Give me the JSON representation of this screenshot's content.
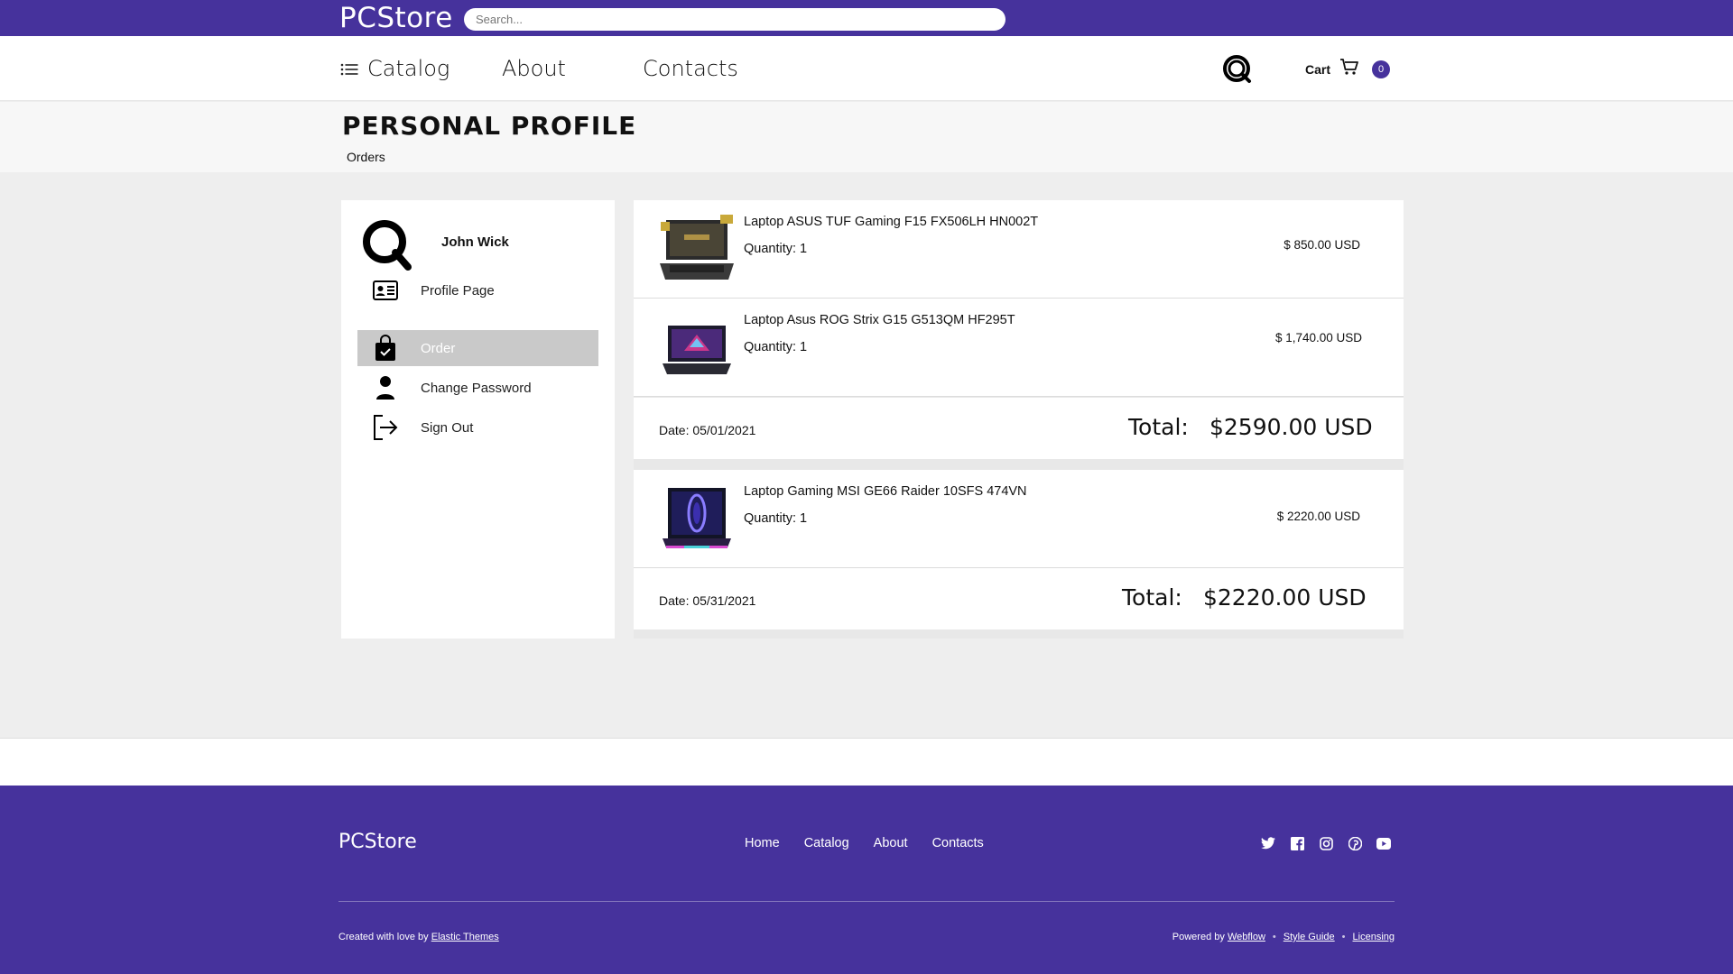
{
  "topbar": {
    "brand": "PCStore",
    "search_placeholder": "Search..."
  },
  "nav": {
    "catalog": "Catalog",
    "about": "About",
    "contacts": "Contacts",
    "cart_label": "Cart",
    "cart_count": "0"
  },
  "page": {
    "title": "PERSONAL PROFILE",
    "breadcrumb": "Orders"
  },
  "sidebar": {
    "username": "John Wick",
    "items": [
      {
        "label": "Profile Page",
        "icon": "id-card-icon"
      },
      {
        "label": "Order",
        "icon": "shopping-bag-icon",
        "active": true
      },
      {
        "label": "Change Password",
        "icon": "user-icon"
      },
      {
        "label": "Sign Out",
        "icon": "sign-out-icon"
      }
    ]
  },
  "orders": [
    {
      "items": [
        {
          "name": "Laptop ASUS TUF Gaming F15 FX506LH HN002T",
          "quantity": "Quantity: 1",
          "price": "$ 850.00 USD"
        },
        {
          "name": "Laptop Asus ROG Strix G15 G513QM HF295T",
          "quantity": "Quantity: 1",
          "price": "$ 1,740.00 USD"
        }
      ],
      "date": "Date: 05/01/2021",
      "total_label": "Total:",
      "total": "$2590.00 USD"
    },
    {
      "items": [
        {
          "name": "Laptop Gaming MSI GE66 Raider 10SFS 474VN",
          "quantity": "Quantity: 1",
          "price": "$ 2220.00 USD"
        }
      ],
      "date": "Date: 05/31/2021",
      "total_label": "Total:",
      "total": "$2220.00 USD"
    }
  ],
  "footer": {
    "brand": "PCStore",
    "links": [
      "Home",
      "Catalog",
      "About",
      "Contacts"
    ],
    "social": [
      "twitter-icon",
      "facebook-icon",
      "instagram-icon",
      "pinterest-icon",
      "youtube-icon"
    ],
    "credit_prefix": "Created with love by",
    "credit_link": "Elastic Themes",
    "powered_prefix": "Powered by",
    "powered_link": "Webflow",
    "style_guide": "Style Guide",
    "licensing": "Licensing",
    "separator": "•"
  },
  "colors": {
    "brand": "#46329c",
    "active_menu": "#c9c9c9"
  }
}
